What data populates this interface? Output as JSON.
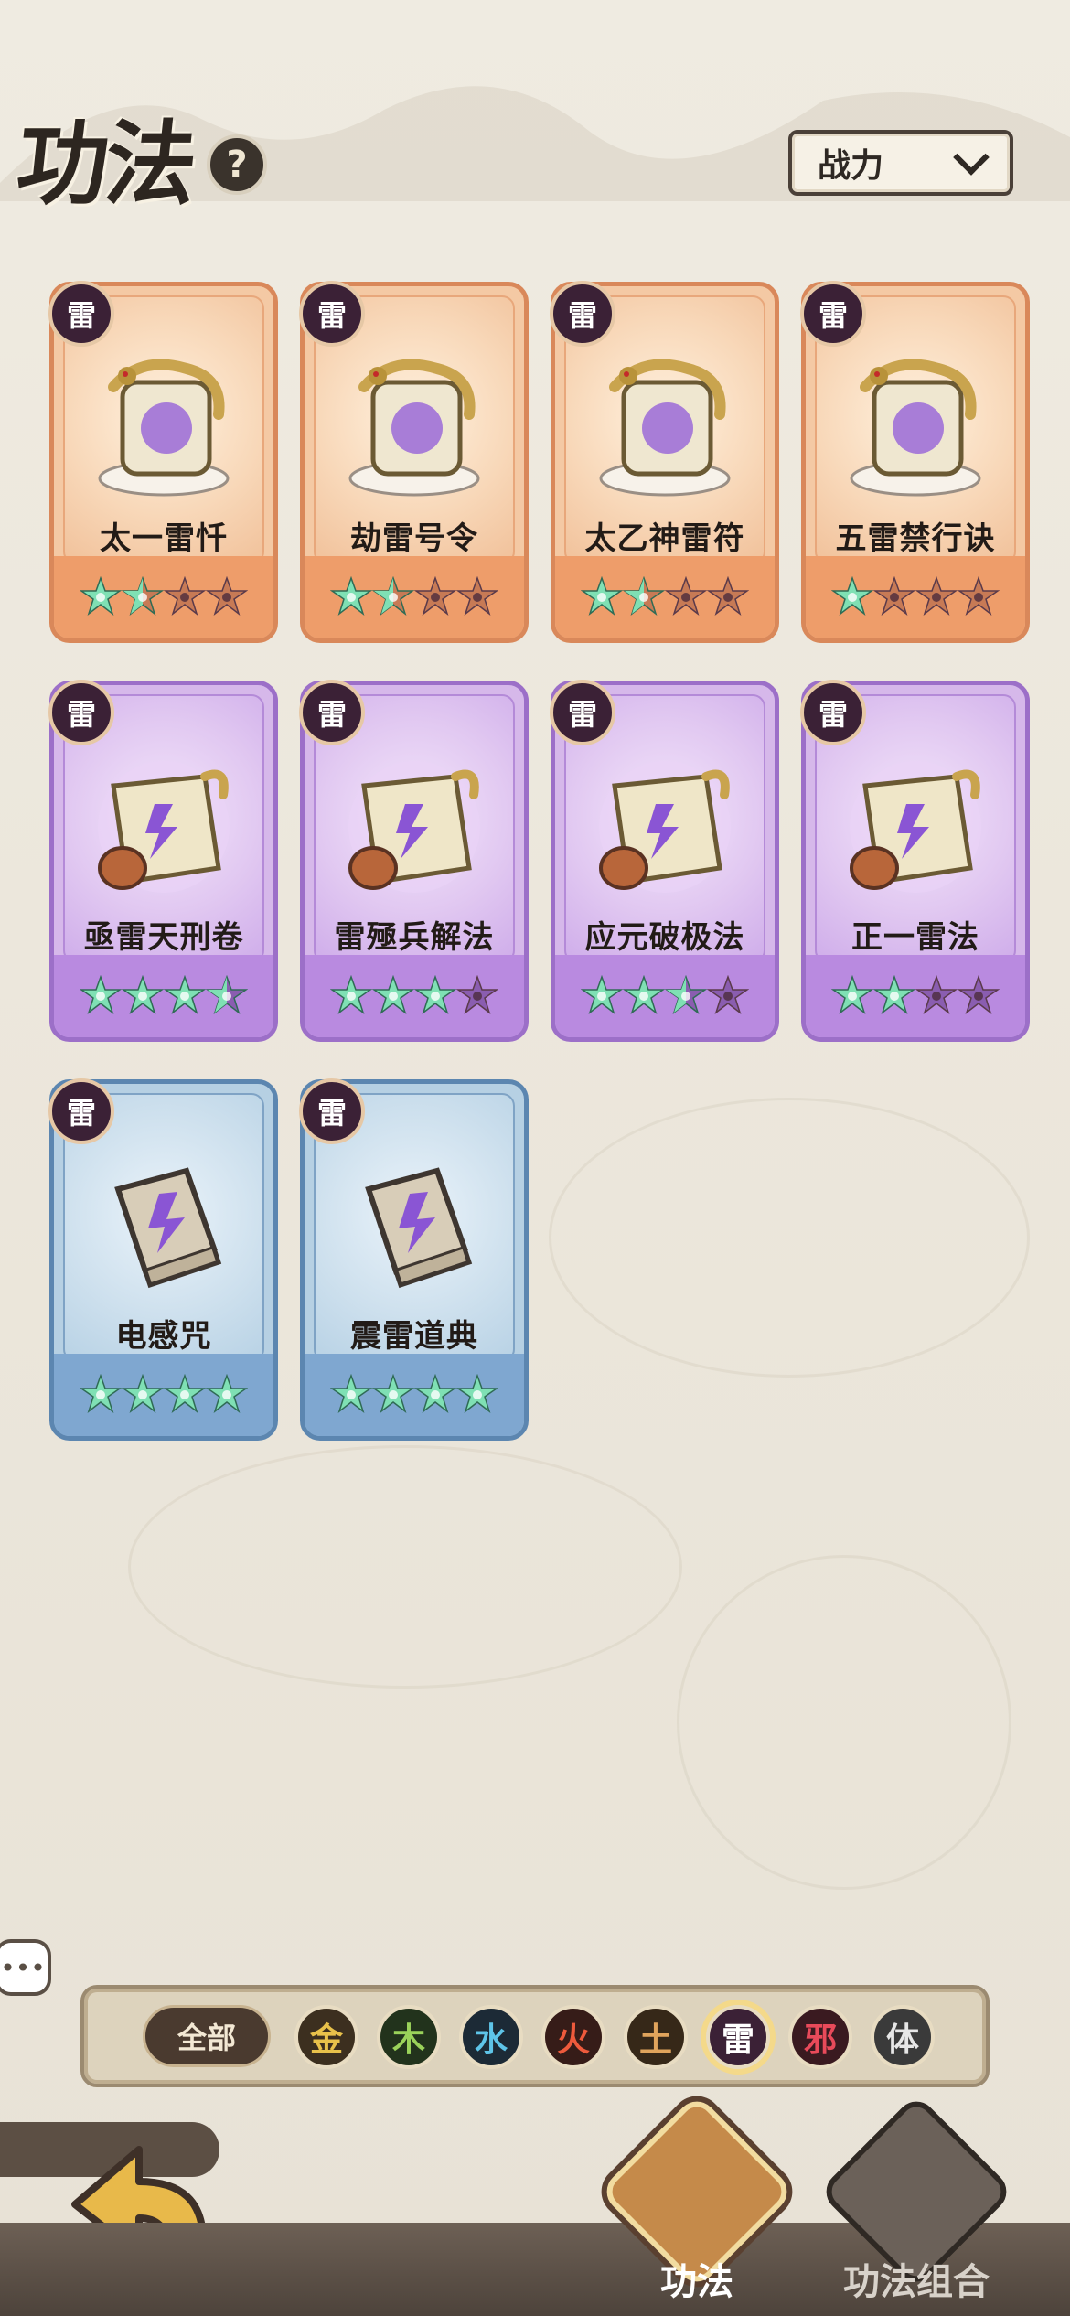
{
  "header": {
    "title": "功法",
    "help_icon": "question-mark-icon",
    "sort_label": "战力"
  },
  "cards": [
    {
      "element": "雷",
      "name": "太一雷忏",
      "rarity": "orange",
      "stars_filled": 1.5,
      "stars_total": 4,
      "art_icon": "dragon-frame-demon-icon"
    },
    {
      "element": "雷",
      "name": "劫雷号令",
      "rarity": "orange",
      "stars_filled": 1.5,
      "stars_total": 4,
      "art_icon": "dragon-frame-hand-icon"
    },
    {
      "element": "雷",
      "name": "太乙神雷符",
      "rarity": "orange",
      "stars_filled": 1.5,
      "stars_total": 4,
      "art_icon": "dragon-frame-talisman-icon"
    },
    {
      "element": "雷",
      "name": "五雷禁行诀",
      "rarity": "orange",
      "stars_filled": 1,
      "stars_total": 4,
      "art_icon": "dragon-frame-seal-icon"
    },
    {
      "element": "雷",
      "name": "亟雷天刑卷",
      "rarity": "purple",
      "stars_filled": 3.5,
      "stars_total": 4,
      "art_icon": "scroll-lightning-icon"
    },
    {
      "element": "雷",
      "name": "雷殛兵解法",
      "rarity": "purple",
      "stars_filled": 3,
      "stars_total": 4,
      "art_icon": "scroll-sword-icon"
    },
    {
      "element": "雷",
      "name": "应元破极法",
      "rarity": "purple",
      "stars_filled": 2.5,
      "stars_total": 4,
      "art_icon": "scroll-spirit-icon"
    },
    {
      "element": "雷",
      "name": "正一雷法",
      "rarity": "purple",
      "stars_filled": 2,
      "stars_total": 4,
      "art_icon": "scroll-thunder-icon"
    },
    {
      "element": "雷",
      "name": "电感咒",
      "rarity": "blue",
      "stars_filled": 4,
      "stars_total": 4,
      "art_icon": "book-lightning-icon"
    },
    {
      "element": "雷",
      "name": "震雷道典",
      "rarity": "blue",
      "stars_filled": 4,
      "stars_total": 4,
      "art_icon": "book-hand-icon"
    }
  ],
  "filters": {
    "all_label": "全部",
    "elements": [
      {
        "label": "金",
        "color": "#e8c14a",
        "bg": "#3c2f1f"
      },
      {
        "label": "木",
        "color": "#9ad25a",
        "bg": "#22331c"
      },
      {
        "label": "水",
        "color": "#5ec4e8",
        "bg": "#1c2a36"
      },
      {
        "label": "火",
        "color": "#ee5a3c",
        "bg": "#361c18"
      },
      {
        "label": "土",
        "color": "#e0a45c",
        "bg": "#362818"
      },
      {
        "label": "雷",
        "color": "#ffffff",
        "bg": "#3b2136",
        "active": true
      },
      {
        "label": "邪",
        "color": "#e84a5a",
        "bg": "#3a1a20"
      },
      {
        "label": "体",
        "color": "#e6e6e6",
        "bg": "#3a3a3a"
      }
    ]
  },
  "nav": {
    "back_icon": "back-arrow-icon",
    "tabs": [
      {
        "label": "功法",
        "icon": "scroll-diamond-icon",
        "active": true
      },
      {
        "label": "功法组合",
        "icon": "combo-diamond-icon",
        "active": false
      }
    ]
  },
  "colors": {
    "star_filled": "#7fe0b4",
    "star_empty_orange": "#c77a55",
    "star_empty_purple": "#8a5db0"
  }
}
